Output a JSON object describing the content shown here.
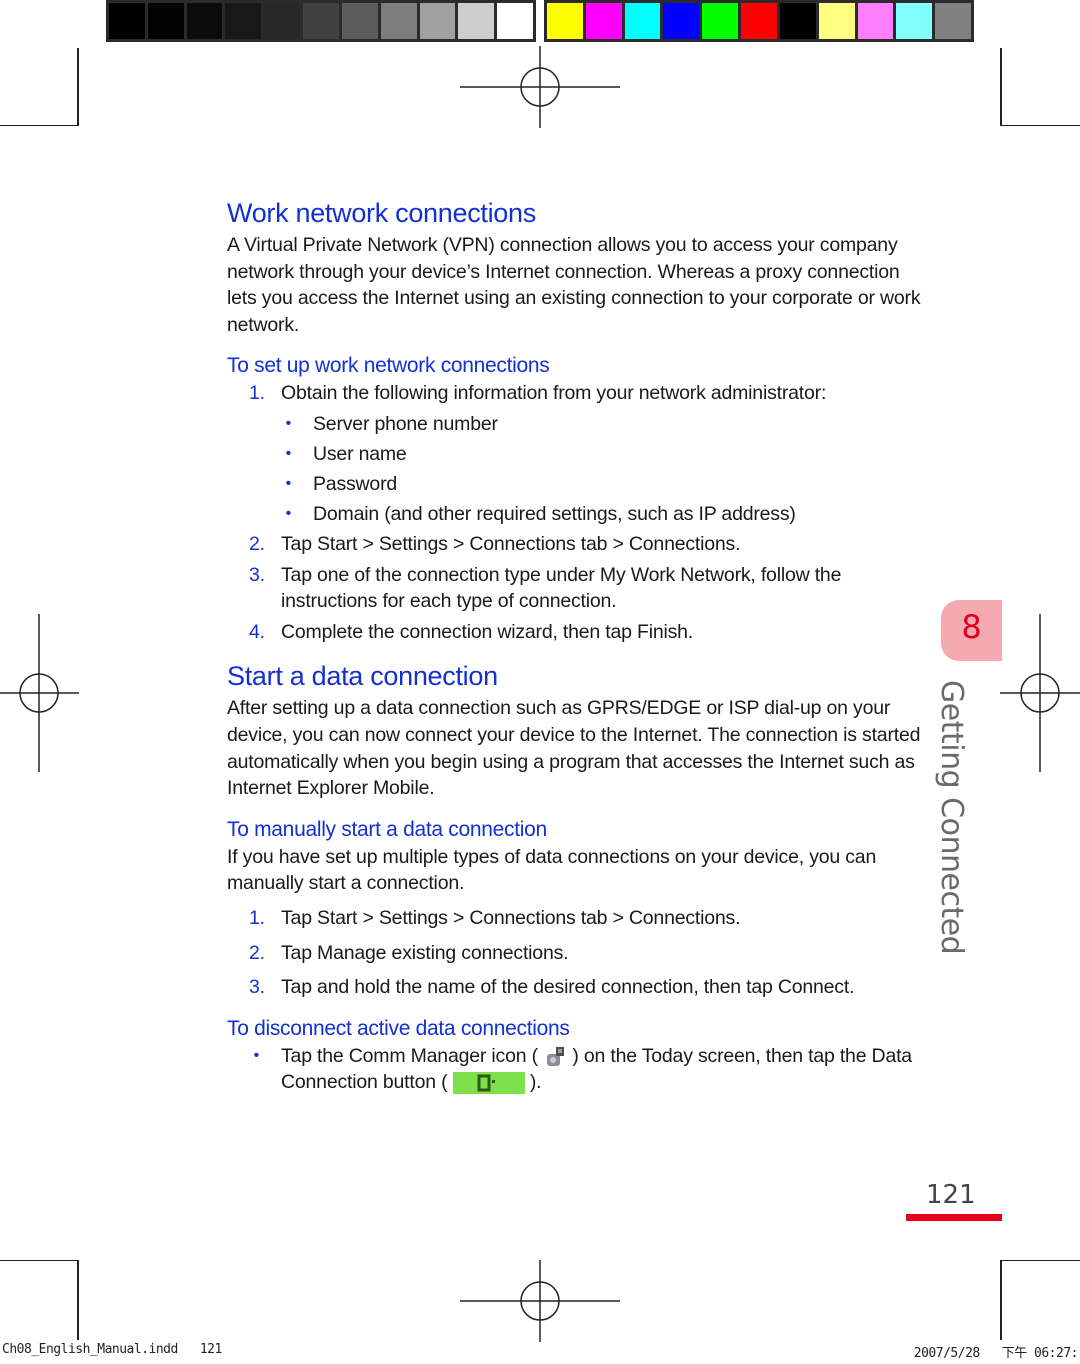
{
  "color_bars": {
    "grayscale": [
      "#000000",
      "#020202",
      "#0b0b0b",
      "#181818",
      "#282828",
      "#414141",
      "#5c5c5c",
      "#7d7d7d",
      "#a0a0a0",
      "#cecece",
      "#ffffff"
    ],
    "process": [
      "#ffff00",
      "#ff00ff",
      "#00ffff",
      "#0000ff",
      "#00ff00",
      "#ff0000",
      "#000000",
      "#ffff80",
      "#ff80ff",
      "#80ffff",
      "#808080"
    ]
  },
  "accent_color": "#1230d4",
  "sections": {
    "work": {
      "title": "Work network connections",
      "intro": "A Virtual Private Network (VPN) connection allows you to access your company network through your device’s Internet connection. Whereas a proxy connection lets you access the Internet using an existing connection to your corporate or work network.",
      "procedure_title": "To set up work network connections",
      "steps": [
        {
          "num": "1.",
          "text": "Obtain the following information from your network administrator:"
        },
        {
          "num": "2.",
          "text": "Tap Start > Settings > Connections tab > Connections."
        },
        {
          "num": "3.",
          "text": "Tap one of the connection type under My Work Network, follow the instructions for each type of connection."
        },
        {
          "num": "4.",
          "text": "Complete the connection wizard, then tap Finish."
        }
      ],
      "info_items": [
        "Server phone number",
        "User name",
        "Password",
        "Domain (and other required settings, such as IP address)"
      ]
    },
    "data": {
      "title": "Start a data connection",
      "intro": "After setting up a data connection such as GPRS/EDGE or ISP dial-up on your device, you can now connect your device to the Internet. The connection is started automatically when you begin using a program that accesses the Internet such as Internet Explorer Mobile.",
      "manual_title": "To manually start a data connection",
      "manual_intro": "If you have set up multiple types of data connections on your device, you can manually start a connection.",
      "manual_steps": [
        {
          "num": "1.",
          "text": "Tap Start > Settings > Connections tab > Connections."
        },
        {
          "num": "2.",
          "text": "Tap Manage existing connections."
        },
        {
          "num": "3.",
          "text": "Tap and hold the name of the desired connection, then tap Connect."
        }
      ],
      "disconnect_title": "To disconnect active data connections",
      "disconnect_text_a": "Tap the Comm Manager icon (",
      "disconnect_text_b": ") on the Today screen, then tap the Data Connection button (",
      "disconnect_text_c": ")."
    }
  },
  "chapter": {
    "number": "8",
    "title": "Getting Connected"
  },
  "page_number": "121",
  "slug": {
    "file": "Ch08_English_Manual.indd   121",
    "date": "2007/5/28   下午 06:27:"
  }
}
